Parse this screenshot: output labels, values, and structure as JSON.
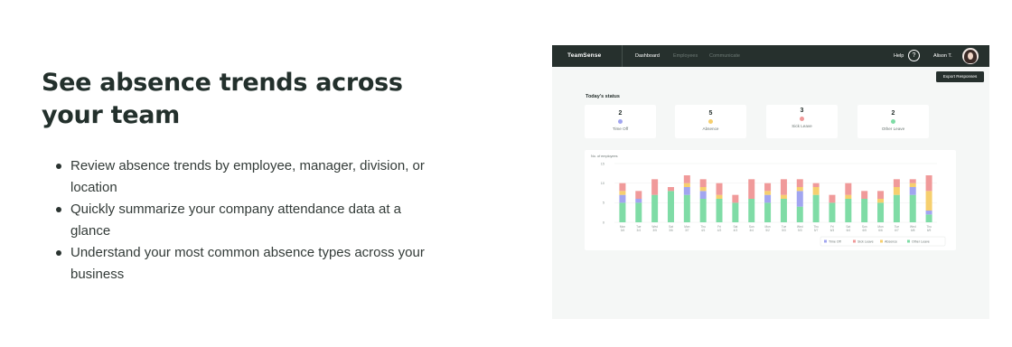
{
  "hero": {
    "title": "See absence trends across your team",
    "bullets": [
      "Review absence trends by employee, manager, division, or location",
      "Quickly summarize your company attendance data at a glance",
      "Understand your most common absence types across your business"
    ]
  },
  "app": {
    "logo": "TeamSense",
    "nav_tabs": [
      "Dashboard",
      "Employees",
      "Communicate"
    ],
    "active_tab": "Dashboard",
    "help_label": "Help",
    "help_icon": "question-icon",
    "user_name": "Alison T.",
    "export_button": "Export Responses",
    "status_title": "Today's status",
    "status_cards": [
      {
        "count": "2",
        "label": "Time Off",
        "color": "#a1a5f0"
      },
      {
        "count": "5",
        "label": "Absence",
        "color": "#f6cf6e"
      },
      {
        "count": "3",
        "label": "Sick Leave",
        "color": "#f09a9a"
      },
      {
        "count": "2",
        "label": "Other Leave",
        "color": "#7fdca6"
      }
    ]
  },
  "chart_data": {
    "type": "bar",
    "stacked": true,
    "ylabel": "No. of employees",
    "ylim": [
      0,
      15
    ],
    "yticks": [
      0,
      5,
      10,
      15
    ],
    "grid": true,
    "legend_position": "bottom-right",
    "categories": [
      {
        "day": "Mon",
        "date": "3/4"
      },
      {
        "day": "Tue",
        "date": "3/4"
      },
      {
        "day": "Wed",
        "date": "3/5"
      },
      {
        "day": "Sat",
        "date": "3/6"
      },
      {
        "day": "Mon",
        "date": "3/7"
      },
      {
        "day": "Thu",
        "date": "4/1"
      },
      {
        "day": "Fri",
        "date": "4/2"
      },
      {
        "day": "Sat",
        "date": "4/3"
      },
      {
        "day": "Sun",
        "date": "4/4"
      },
      {
        "day": "Mon",
        "date": "5/2"
      },
      {
        "day": "Tue",
        "date": "5/3"
      },
      {
        "day": "Wed",
        "date": "5/3"
      },
      {
        "day": "Thu",
        "date": "5/7"
      },
      {
        "day": "Fri",
        "date": "6/3"
      },
      {
        "day": "Sat",
        "date": "6/4"
      },
      {
        "day": "Sun",
        "date": "6/5"
      },
      {
        "day": "Mon",
        "date": "6/6"
      },
      {
        "day": "Tue",
        "date": "6/7"
      },
      {
        "day": "Wed",
        "date": "6/8"
      },
      {
        "day": "Thu",
        "date": "6/9"
      }
    ],
    "series": [
      {
        "name": "Other Leave",
        "color": "#7fdca6",
        "values": [
          5,
          5,
          7,
          8,
          7,
          6,
          6,
          5,
          6,
          5,
          6,
          4,
          7,
          5,
          6,
          6,
          5,
          7,
          7,
          2
        ]
      },
      {
        "name": "Time Off",
        "color": "#a1a5f0",
        "values": [
          2,
          1,
          0,
          0,
          2,
          2,
          0,
          0,
          0,
          2,
          0,
          4,
          0,
          0,
          0,
          0,
          0,
          0,
          2,
          1
        ]
      },
      {
        "name": "Absence",
        "color": "#f6cf6e",
        "values": [
          1,
          0,
          0,
          0,
          1,
          1,
          1,
          0,
          0,
          1,
          1,
          1,
          2,
          0,
          1,
          0,
          1,
          2,
          1,
          5
        ]
      },
      {
        "name": "Sick Leave",
        "color": "#f09a9a",
        "values": [
          2,
          2,
          4,
          1,
          2,
          2,
          3,
          2,
          5,
          2,
          4,
          2,
          1,
          2,
          3,
          2,
          2,
          2,
          1,
          4
        ]
      }
    ],
    "legend": [
      "Time Off",
      "Sick Leave",
      "Absence",
      "Other Leave"
    ]
  }
}
